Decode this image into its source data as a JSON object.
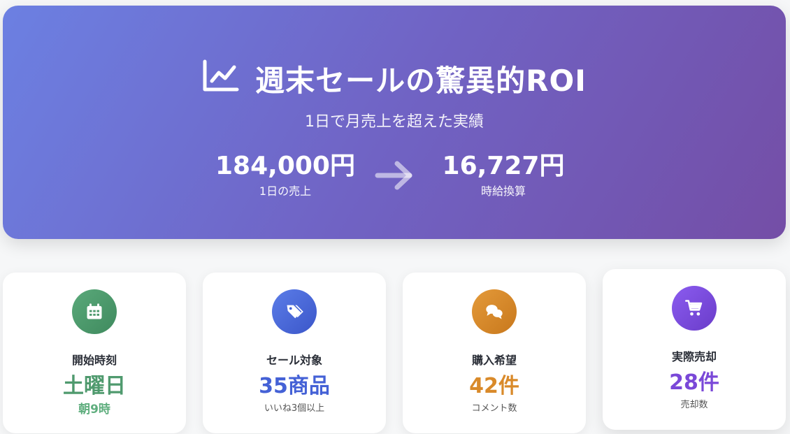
{
  "hero": {
    "title": "週末セールの驚異的ROI",
    "icon": "line-chart-icon",
    "subtitle": "1日で月売上を超えた実績",
    "metric_left": {
      "value": "184,000円",
      "label": "1日の売上"
    },
    "metric_right": {
      "value": "16,727円",
      "label": "時給換算"
    }
  },
  "cards": [
    {
      "icon": "calendar-icon",
      "title": "開始時刻",
      "value": "土曜日",
      "note": "朝9時",
      "color": "#4f9a6e"
    },
    {
      "icon": "tag-icon",
      "title": "セール対象",
      "value": "35商品",
      "note": "いいね3個以上",
      "color": "#4461d6"
    },
    {
      "icon": "chat-bubbles-icon",
      "title": "購入希望",
      "value": "42件",
      "note": "コメント数",
      "color": "#d98a2a"
    },
    {
      "icon": "cart-icon",
      "title": "実際売却",
      "value": "28件",
      "note": "売却数",
      "color": "#7a48d8"
    }
  ]
}
